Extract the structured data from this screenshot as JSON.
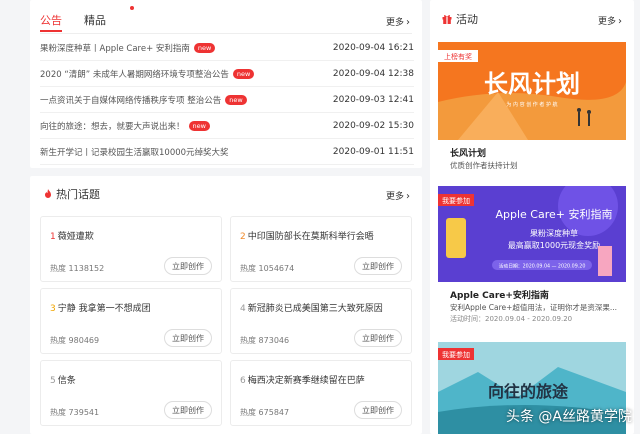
{
  "notice": {
    "tabs": [
      {
        "label": "公告"
      },
      {
        "label": "精品"
      }
    ],
    "more_label": "更多",
    "items": [
      {
        "title": "果粉深度种草丨Apple Care+ 安利指南",
        "badge": "new",
        "date": "2020-09-04 16:21"
      },
      {
        "title": "2020 “清朗” 未成年人暑期网络环境专项整治公告",
        "badge": "new",
        "date": "2020-09-04 12:38"
      },
      {
        "title": "一点资讯关于自媒体网络传播秩序专项 整治公告",
        "badge": "new",
        "date": "2020-09-03 12:41"
      },
      {
        "title": "向往的旅途：想去，就要大声说出来！",
        "badge": "new",
        "date": "2020-09-02 15:30"
      },
      {
        "title": "新生开学记丨记录校园生活赢取10000元绰奖大奖",
        "badge": "",
        "date": "2020-09-01 11:51"
      }
    ]
  },
  "topics": {
    "title": "热门话题",
    "more_label": "更多",
    "heat_prefix": "热度",
    "create_label": "立即创作",
    "items": [
      {
        "rank": "1",
        "name": "薇娅遭欺",
        "heat": "1138152"
      },
      {
        "rank": "2",
        "name": "中印国防部长在莫斯科举行会晤",
        "heat": "1054674"
      },
      {
        "rank": "3",
        "name": "宁静 我拿第一不想成团",
        "heat": "980469"
      },
      {
        "rank": "4",
        "name": "新冠肺炎已成美国第三大致死原因",
        "heat": "873046"
      },
      {
        "rank": "5",
        "name": "信条",
        "heat": "739541"
      },
      {
        "rank": "6",
        "name": "梅西决定新赛季继续留在巴萨",
        "heat": "675847"
      }
    ]
  },
  "activity": {
    "title": "活动",
    "more_label": "更多",
    "items": [
      {
        "banner_tag": "上榜有奖",
        "banner_title": "长风计划",
        "banner_sub": "为 内 容 创 作 者 护 航",
        "name": "长风计划",
        "desc": "优质创作者扶持计划",
        "time": ""
      },
      {
        "banner_tag": "我要参加",
        "banner_title": "Apple Care+ 安利指南",
        "banner_sub": "果粉深度种草",
        "banner_sub2": "最高赢取1000元现金奖励",
        "banner_date": "活动日期：2020.09.04 — 2020.09.20",
        "name": "Apple Care+安利指南",
        "desc": "安利Apple Care+超值用法，证明你才是资深果...",
        "time": "活动时间：2020.09.04 - 2020.09.20"
      },
      {
        "banner_tag": "我要参加",
        "banner_title": "向往的旅途",
        "name": "",
        "desc": "",
        "time": ""
      }
    ]
  },
  "watermark": "头条 @A丝路黄学院",
  "colors": {
    "accent": "#e33333",
    "orange": "#f08c2e",
    "purple": "#5a3fd1",
    "teal": "#4fb5c9"
  }
}
